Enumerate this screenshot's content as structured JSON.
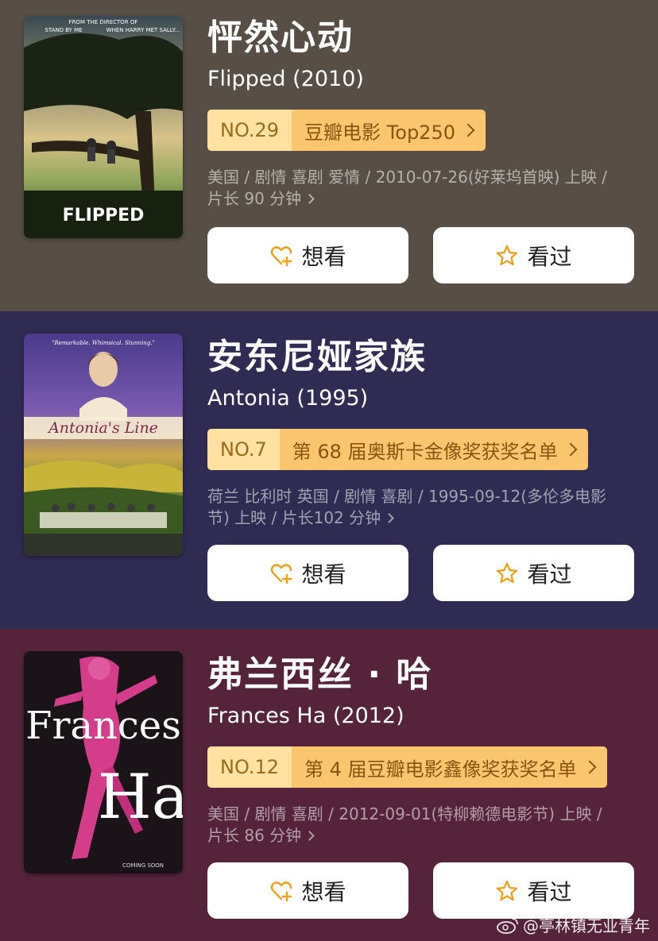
{
  "movies": [
    {
      "title_cn": "怦然心动",
      "title_en": "Flipped (2010)",
      "rank_no": "NO.29",
      "rank_list": "豆瓣电影 Top250",
      "meta": "美国 / 剧情 喜剧 爱情 / 2010-07-26(好莱坞首映) 上映 / 片长 90 分钟",
      "poster_texts": {
        "tagline": "FROM THE DIRECTOR OF",
        "line1": "STAND BY ME",
        "line2": "WHEN HARRY MET SALLY...",
        "name": "FLIPPED"
      },
      "want_label": "想看",
      "seen_label": "看过"
    },
    {
      "title_cn": "安东尼娅家族",
      "title_en": "Antonia (1995)",
      "rank_no": "NO.7",
      "rank_list": "第 68 届奥斯卡金像奖获奖名单",
      "meta": "荷兰 比利时 英国 / 剧情 喜剧 / 1995-09-12(多伦多电影节) 上映 / 片长102 分钟",
      "poster_texts": {
        "tagline": "\"Remarkable. Whimsical. Stunning.\"",
        "name": "Antonia's Line"
      },
      "want_label": "想看",
      "seen_label": "看过"
    },
    {
      "title_cn": "弗兰西丝 · 哈",
      "title_en": "Frances Ha (2012)",
      "rank_no": "NO.12",
      "rank_list": "第 4 届豆瓣电影鑫像奖获奖名单",
      "meta": "美国 / 剧情 喜剧 / 2012-09-01(特柳赖德电影节) 上映 / 片长 86 分钟",
      "poster_texts": {
        "name1": "Frances",
        "name2": "Ha",
        "coming": "COMING SOON"
      },
      "want_label": "想看",
      "seen_label": "看过"
    }
  ],
  "watermark": "@亭林镇无业青年",
  "colors": {
    "card1_bg": "#574f45",
    "card2_bg": "#2f2b52",
    "card3_bg": "#55243a",
    "rank_no_bg": "#ffe1a1",
    "rank_list_bg": "#f9c66f",
    "icon_accent": "#f0a020"
  },
  "icons": {
    "want": "heart-plus-icon",
    "seen": "star-icon",
    "watermark": "weibo-icon"
  }
}
